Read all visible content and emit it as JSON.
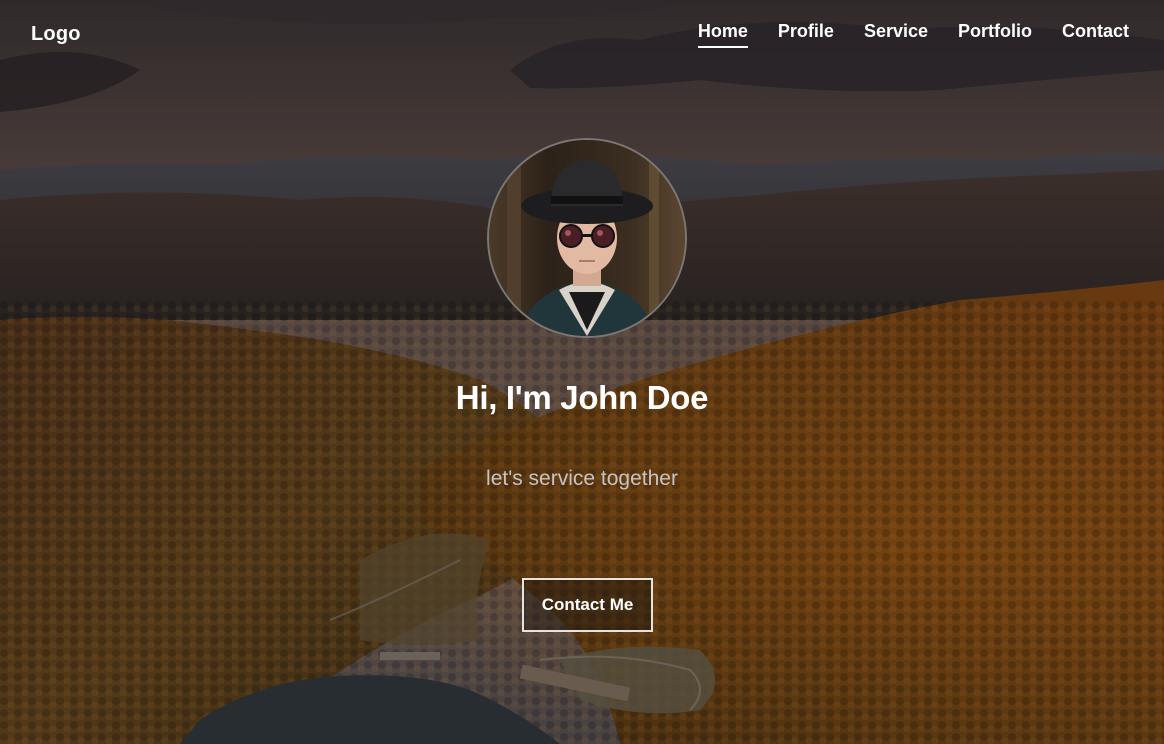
{
  "navbar": {
    "logo": "Logo",
    "links": [
      {
        "label": "Home",
        "active": true
      },
      {
        "label": "Profile",
        "active": false
      },
      {
        "label": "Service",
        "active": false
      },
      {
        "label": "Portfolio",
        "active": false
      },
      {
        "label": "Contact",
        "active": false
      }
    ]
  },
  "hero": {
    "headline": "Hi, I'm John Doe",
    "subtitle": "let's service together",
    "cta_label": "Contact Me"
  },
  "colors": {
    "text": "#ffffff",
    "subtitle": "#c7c3c0",
    "button_border": "#e6e3e0",
    "avatar_border": "#7a7774"
  },
  "icons": {
    "background": "autumn-mountain-landscape-image",
    "avatar": "profile-photo-man-with-hat-and-sunglasses"
  }
}
